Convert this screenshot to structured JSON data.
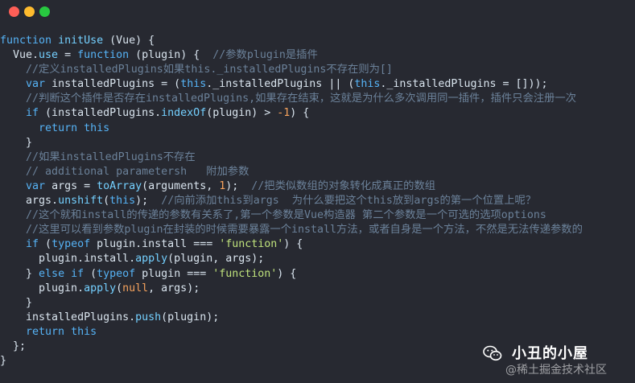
{
  "window": {
    "controls": [
      "close",
      "minimize",
      "maximize"
    ]
  },
  "code": {
    "lines": [
      [
        [
          "function ",
          "kw"
        ],
        [
          "initUse",
          "fn"
        ],
        [
          " (Vue) {",
          "pn"
        ]
      ],
      [
        [
          "  Vue",
          "pn"
        ],
        [
          ".",
          "pn"
        ],
        [
          "use",
          "prop"
        ],
        [
          " = ",
          "pn"
        ],
        [
          "function",
          "kw"
        ],
        [
          " (plugin) {  ",
          "pn"
        ],
        [
          "//参数plugin是插件",
          "cm"
        ]
      ],
      [
        [
          "    ",
          "pn"
        ],
        [
          "//定义installedPlugins如果this._installedPlugins不存在则为[]",
          "cm"
        ]
      ],
      [
        [
          "    ",
          "pn"
        ],
        [
          "var",
          "kw"
        ],
        [
          " installedPlugins = (",
          "pn"
        ],
        [
          "this",
          "kw"
        ],
        [
          "._installedPlugins || (",
          "pn"
        ],
        [
          "this",
          "kw"
        ],
        [
          "._installedPlugins = []));",
          "pn"
        ]
      ],
      [
        [
          "    ",
          "pn"
        ],
        [
          "//判断这个插件是否存在installedPlugins,如果存在结束，这就是为什么多次调用同一插件，插件只会注册一次",
          "cm"
        ]
      ],
      [
        [
          "    ",
          "pn"
        ],
        [
          "if",
          "kw"
        ],
        [
          " (installedPlugins.",
          "pn"
        ],
        [
          "indexOf",
          "prop"
        ],
        [
          "(plugin) > ",
          "pn"
        ],
        [
          "-1",
          "nm"
        ],
        [
          ") {",
          "pn"
        ]
      ],
      [
        [
          "      ",
          "pn"
        ],
        [
          "return",
          "kw"
        ],
        [
          " ",
          "pn"
        ],
        [
          "this",
          "kw"
        ]
      ],
      [
        [
          "    }",
          "pn"
        ]
      ],
      [
        [
          "    ",
          "pn"
        ],
        [
          "//如果installedPlugins不存在",
          "cm"
        ]
      ],
      [
        [
          "    ",
          "pn"
        ],
        [
          "// additional parametersh   附加参数",
          "cm"
        ]
      ],
      [
        [
          "    ",
          "pn"
        ],
        [
          "var",
          "kw"
        ],
        [
          " args = ",
          "pn"
        ],
        [
          "toArray",
          "fn"
        ],
        [
          "(arguments, ",
          "pn"
        ],
        [
          "1",
          "nm"
        ],
        [
          ");  ",
          "pn"
        ],
        [
          "//把类似数组的对象转化成真正的数组",
          "cm"
        ]
      ],
      [
        [
          "    args.",
          "pn"
        ],
        [
          "unshift",
          "prop"
        ],
        [
          "(",
          "pn"
        ],
        [
          "this",
          "kw"
        ],
        [
          ");  ",
          "pn"
        ],
        [
          "//向前添加this到args  为什么要把这个this放到args的第一个位置上呢？",
          "cm"
        ]
      ],
      [
        [
          "    ",
          "pn"
        ],
        [
          "//这个就和install的传递的参数有关系了,第一个参数是Vue构造器 第二个参数是一个可选的选项options",
          "cm"
        ]
      ],
      [
        [
          "    ",
          "pn"
        ],
        [
          "//这里可以看到参数plugin在封装的时候需要暴露一个install方法，或者自身是一个方法，不然是无法传递参数的",
          "cm"
        ]
      ],
      [
        [
          "    ",
          "pn"
        ],
        [
          "if",
          "kw"
        ],
        [
          " (",
          "pn"
        ],
        [
          "typeof",
          "kw"
        ],
        [
          " plugin.install === ",
          "pn"
        ],
        [
          "'function'",
          "st"
        ],
        [
          ") {",
          "pn"
        ]
      ],
      [
        [
          "      plugin.install.",
          "pn"
        ],
        [
          "apply",
          "prop"
        ],
        [
          "(plugin, args);",
          "pn"
        ]
      ],
      [
        [
          "    } ",
          "pn"
        ],
        [
          "else if",
          "kw"
        ],
        [
          " (",
          "pn"
        ],
        [
          "typeof",
          "kw"
        ],
        [
          " plugin === ",
          "pn"
        ],
        [
          "'function'",
          "st"
        ],
        [
          ") {",
          "pn"
        ]
      ],
      [
        [
          "      plugin.",
          "pn"
        ],
        [
          "apply",
          "prop"
        ],
        [
          "(",
          "pn"
        ],
        [
          "null",
          "nm"
        ],
        [
          ", args);",
          "pn"
        ]
      ],
      [
        [
          "    }",
          "pn"
        ]
      ],
      [
        [
          "    installedPlugins.",
          "pn"
        ],
        [
          "push",
          "prop"
        ],
        [
          "(plugin);",
          "pn"
        ]
      ],
      [
        [
          "    ",
          "pn"
        ],
        [
          "return",
          "kw"
        ],
        [
          " ",
          "pn"
        ],
        [
          "this",
          "kw"
        ]
      ],
      [
        [
          "  };",
          "pn"
        ]
      ],
      [
        [
          "}",
          "pn"
        ]
      ]
    ]
  },
  "watermark": {
    "title": "小丑的小屋",
    "subtitle": "@稀土掘金技术社区",
    "icon": "wechat-icon"
  }
}
